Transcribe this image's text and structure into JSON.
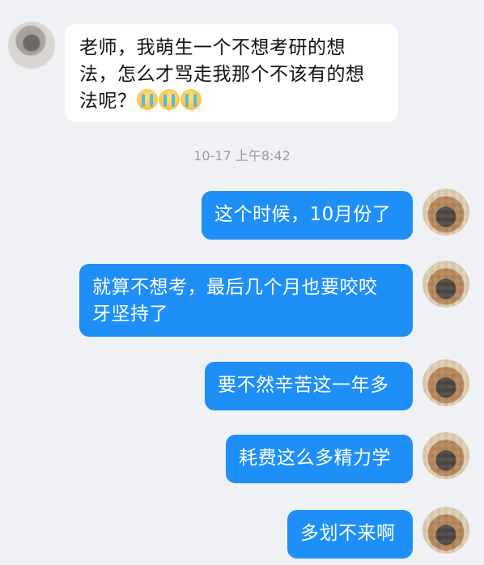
{
  "chat": {
    "incoming": {
      "line1": "老师，我萌生一个不想考研的想",
      "line2": "法，怎么才骂走我那个不该有的想",
      "line3": "法呢？",
      "emoji": "crying-face"
    },
    "timestamp": "10-17 上午8:42",
    "outgoing": [
      {
        "text": "这个时候，10月份了"
      },
      {
        "text": "就算不想考，最后几个月也要咬咬",
        "text2": "牙坚持了"
      },
      {
        "text": "要不然辛苦这一年多"
      },
      {
        "text": "耗费这么多精力学"
      },
      {
        "text": "多划不来啊"
      }
    ]
  },
  "colors": {
    "background": "#f0f1f5",
    "outgoing_bubble": "#1e8ff6",
    "incoming_bubble": "#ffffff"
  }
}
